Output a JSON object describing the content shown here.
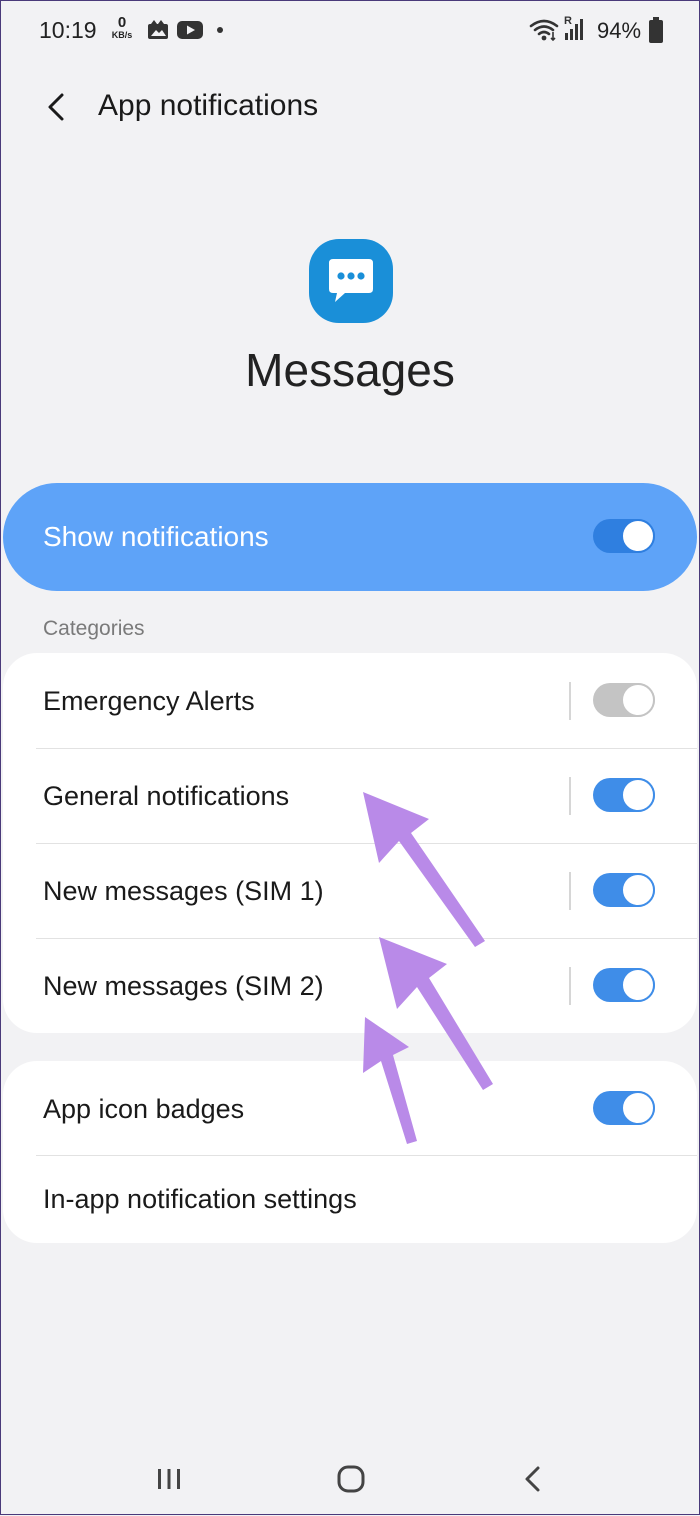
{
  "status_bar": {
    "time": "10:19",
    "net_speed_value": "0",
    "net_speed_unit": "KB/s",
    "sim_indicator": "R",
    "battery": "94%",
    "icons": [
      "image-icon",
      "youtube-icon",
      "notification-dot-icon",
      "wifi-icon",
      "signal-icon",
      "battery-icon"
    ]
  },
  "header": {
    "back_icon": "back-chevron-icon",
    "title": "App notifications"
  },
  "app": {
    "icon": "messages-app-icon",
    "name": "Messages",
    "icon_color": "#1a8fd8"
  },
  "master_toggle": {
    "label": "Show notifications",
    "enabled": true
  },
  "categories": {
    "label": "Categories",
    "items": [
      {
        "label": "Emergency Alerts",
        "enabled": true,
        "disabled": true
      },
      {
        "label": "General notifications",
        "enabled": true,
        "disabled": false
      },
      {
        "label": "New messages (SIM 1)",
        "enabled": true,
        "disabled": false
      },
      {
        "label": "New messages (SIM 2)",
        "enabled": true,
        "disabled": false
      }
    ]
  },
  "other_settings": {
    "items": [
      {
        "label": "App icon badges",
        "enabled": true,
        "has_toggle": true
      },
      {
        "label": "In-app notification settings",
        "has_toggle": false
      }
    ]
  },
  "nav_bar": {
    "icons": [
      "recent-apps-icon",
      "home-icon",
      "back-icon"
    ]
  },
  "colors": {
    "accent": "#3f8de8",
    "master_card": "#5ea3f8",
    "annotation_arrow": "#b98ae8",
    "background": "#f2f2f4"
  }
}
